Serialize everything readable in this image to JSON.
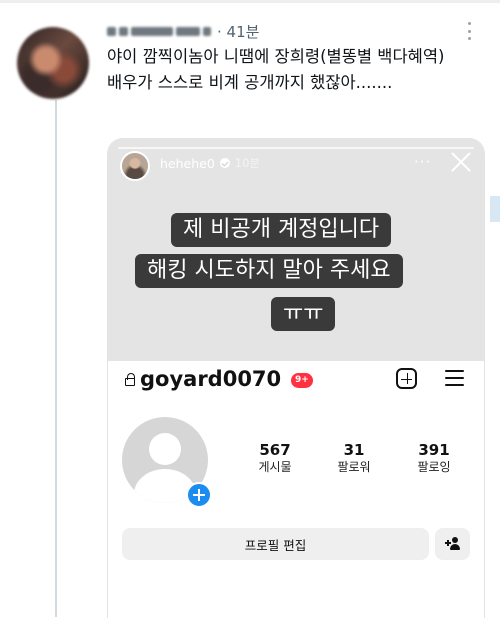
{
  "tweet": {
    "timestamp": "· 41분",
    "body": "야이 깜찍이놈아 니땜에 장희령(별똥별 백다혜역) 배우가 스스로 비계 공개까지 했잖아......."
  },
  "story": {
    "username": "hehehe0",
    "time": "10분",
    "more": "···",
    "caption_line1": "제 비공개 계정입니다",
    "caption_line2": "해킹 시도하지 말아 주세요",
    "caption_line3": "ㅠㅠ"
  },
  "profile": {
    "handle": "goyard0070",
    "notification_badge": "9+",
    "stats": [
      {
        "value": "567",
        "label": "게시물"
      },
      {
        "value": "31",
        "label": "팔로워"
      },
      {
        "value": "391",
        "label": "팔로잉"
      }
    ],
    "edit_button": "프로필 편집"
  },
  "colors": {
    "story_overlay": "#3a3a3a",
    "badge_red": "#ff3040",
    "avatar_plus_blue": "#1c8cf0",
    "thread_line": "#cfd9de"
  }
}
